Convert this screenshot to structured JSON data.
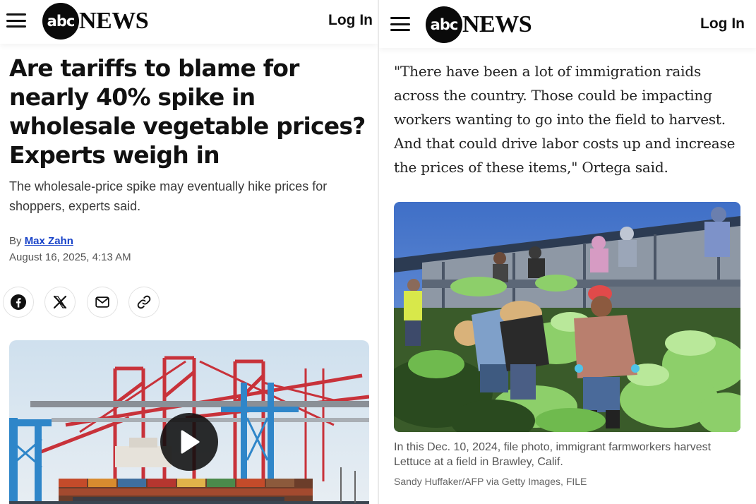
{
  "brand": {
    "logo_mark": "abc",
    "logo_word": "NEWS"
  },
  "header": {
    "login_label": "Log In",
    "menu_icon": "hamburger-menu-icon"
  },
  "left_article": {
    "headline": "Are tariffs to blame for nearly 40% spike in wholesale vegetable prices? Experts weigh in",
    "subhead": "The wholesale-price spike may eventually hike prices for shoppers, experts said.",
    "byline_prefix": "By",
    "author": "Max Zahn",
    "date": "August 16, 2025, 4:13 AM",
    "share_icons": [
      "facebook-icon",
      "x-icon",
      "mail-icon",
      "link-icon"
    ],
    "video": {
      "subject": "container port cranes",
      "play_icon": "play-icon"
    }
  },
  "right_article": {
    "quote": "\"There have been a lot of immigration raids across the country. Those could be impacting workers wanting to go into the field to harvest. And that could drive labor costs up and increase the prices of these items,\" Ortega said.",
    "photo": {
      "subject": "farmworkers harvesting lettuce"
    },
    "caption": "In this Dec. 10, 2024, file photo, immigrant farmworkers harvest Lettuce at a field in Brawley, Calif.",
    "credit": "Sandy Huffaker/AFP via Getty Images, FILE"
  },
  "colors": {
    "link_blue": "#1742c8",
    "text_dark": "#111111",
    "text_gray": "#555555",
    "crane_red": "#c8323a",
    "crane_blue": "#2f86c9"
  }
}
